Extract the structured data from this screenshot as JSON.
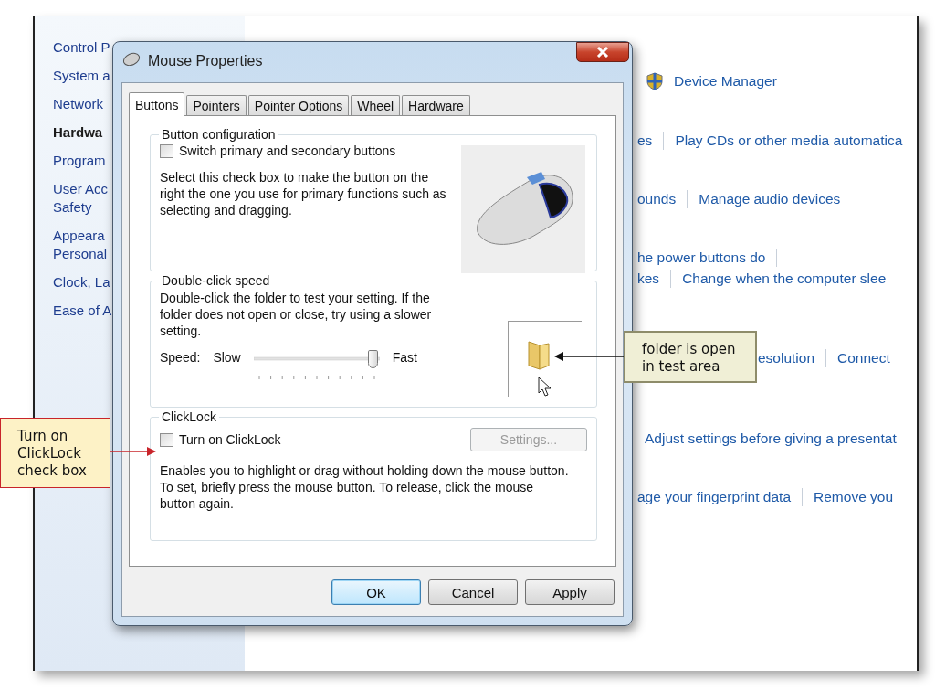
{
  "control_panel": {
    "nav": [
      {
        "label": "Control P",
        "selected": false
      },
      {
        "label": "System a",
        "selected": false
      },
      {
        "label": "Network",
        "selected": false
      },
      {
        "label": "Hardwa",
        "selected": true
      },
      {
        "label": "Program",
        "selected": false
      },
      {
        "label": "User Acc Safety",
        "selected": false
      },
      {
        "label": "Appeara Personal",
        "selected": false
      },
      {
        "label": "Clock, La",
        "selected": false
      },
      {
        "label": "Ease of A",
        "selected": false
      }
    ],
    "rows": [
      {
        "kind": "shield",
        "links": [
          "Device Manager"
        ],
        "trailing_separator": false
      },
      {
        "kind": "plain",
        "links": [
          "es",
          "Play CDs or other media automatica"
        ],
        "trailing_separator": false
      },
      {
        "kind": "plain",
        "links": [
          "ounds",
          "Manage audio devices"
        ],
        "trailing_separator": false
      },
      {
        "kind": "plain",
        "links": [
          "he power buttons do"
        ],
        "trailing_separator": true
      },
      {
        "kind": "plain",
        "links": [
          "kes",
          "Change when the computer slee"
        ],
        "trailing_separator": false
      },
      {
        "kind": "plain",
        "links": [
          "esolution",
          "Connect"
        ],
        "trailing_separator": false
      },
      {
        "kind": "plain",
        "links": [
          "Adjust settings before giving a presentat"
        ],
        "trailing_separator": false
      },
      {
        "kind": "plain",
        "links": [
          "age your fingerprint data",
          "Remove you"
        ],
        "trailing_separator": false
      }
    ]
  },
  "dialog": {
    "title": "Mouse Properties",
    "tabs": [
      {
        "label": "Buttons",
        "selected": true
      },
      {
        "label": "Pointers",
        "selected": false
      },
      {
        "label": "Pointer Options",
        "selected": false
      },
      {
        "label": "Wheel",
        "selected": false
      },
      {
        "label": "Hardware",
        "selected": false
      }
    ],
    "button_configuration": {
      "legend": "Button configuration",
      "checkbox": {
        "label": "Switch primary and secondary buttons",
        "checked": false
      },
      "description": "Select this check box to make the button on the right the one you use for primary functions such as selecting and dragging."
    },
    "double_click_speed": {
      "legend": "Double-click speed",
      "description": "Double-click the folder to test your setting. If the folder does not open or close, try using a slower setting.",
      "speed_label": "Speed:",
      "min_label": "Slow",
      "max_label": "Fast",
      "level": 0.95
    },
    "clicklock": {
      "legend": "ClickLock",
      "checkbox": {
        "label": "Turn on ClickLock",
        "checked": false
      },
      "settings_button": {
        "label": "Settings...",
        "disabled": true
      },
      "description": "Enables you to highlight or drag without holding down the mouse button. To set, briefly press the mouse button. To release, click the mouse button again."
    },
    "buttons": [
      {
        "label": "OK",
        "default": true
      },
      {
        "label": "Cancel",
        "default": false
      },
      {
        "label": "Apply",
        "default": false
      }
    ]
  },
  "callouts": [
    {
      "kind": "note",
      "text": "folder is open in test area"
    },
    {
      "kind": "step",
      "text": "Turn on ClickLock check box"
    }
  ]
}
